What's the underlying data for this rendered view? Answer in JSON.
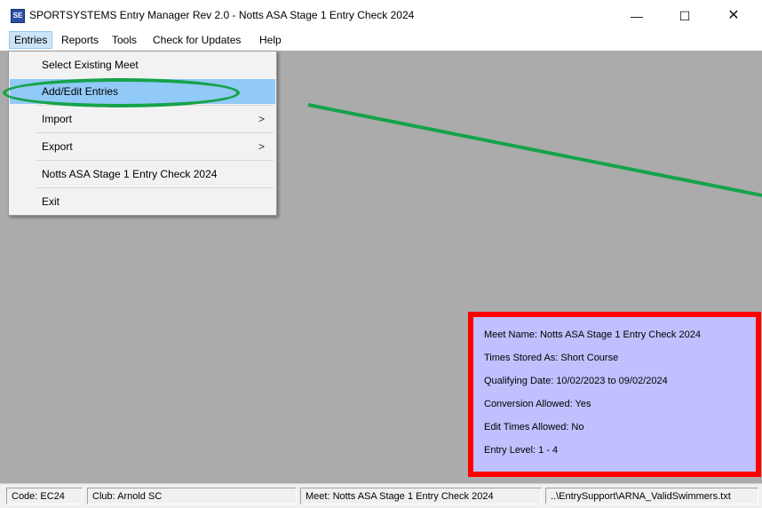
{
  "window": {
    "title": "SPORTSYSTEMS Entry Manager Rev 2.0 - Notts ASA Stage 1 Entry Check 2024",
    "app_icon": "SE",
    "minimize_icon": "—",
    "maximize_icon": "☐",
    "close_icon": "✕"
  },
  "menubar": {
    "items": [
      {
        "label": "Entries",
        "active": true
      },
      {
        "label": "Reports"
      },
      {
        "label": "Tools"
      },
      {
        "label": "Check for Updates"
      },
      {
        "label": "Help"
      }
    ]
  },
  "entries_menu": {
    "items": [
      {
        "label": "Select Existing Meet"
      },
      {
        "label": "Add/Edit Entries",
        "highlighted": true
      },
      {
        "label": "Import",
        "submenu_arrow": ">"
      },
      {
        "label": "Export",
        "submenu_arrow": ">"
      },
      {
        "label": "Notts ASA Stage 1 Entry Check 2024"
      },
      {
        "label": "Exit"
      }
    ]
  },
  "meet_info": {
    "meet_name": "Meet Name: Notts ASA Stage 1 Entry Check 2024",
    "times_stored": "Times Stored As: Short Course",
    "qualifying_date": "Qualifying Date: 10/02/2023 to 09/02/2024",
    "conversion_allowed": "Conversion Allowed: Yes",
    "edit_times_allowed": "Edit Times Allowed: No",
    "entry_level": "Entry Level: 1 - 4"
  },
  "statusbar": {
    "code": "Code: EC24",
    "club": "Club: Arnold SC",
    "meet": "Meet: Notts ASA Stage 1 Entry Check 2024",
    "file": "..\\EntrySupport\\ARNA_ValidSwimmers.txt"
  },
  "colors": {
    "annotation_green": "#16a34a",
    "annotation_red": "#ff0000",
    "info_background": "#c0c0ff",
    "client_background": "#ababab",
    "menu_highlight": "#91c9f7"
  },
  "icons": {
    "app": "app-icon",
    "submenu": "chevron-right-icon"
  }
}
